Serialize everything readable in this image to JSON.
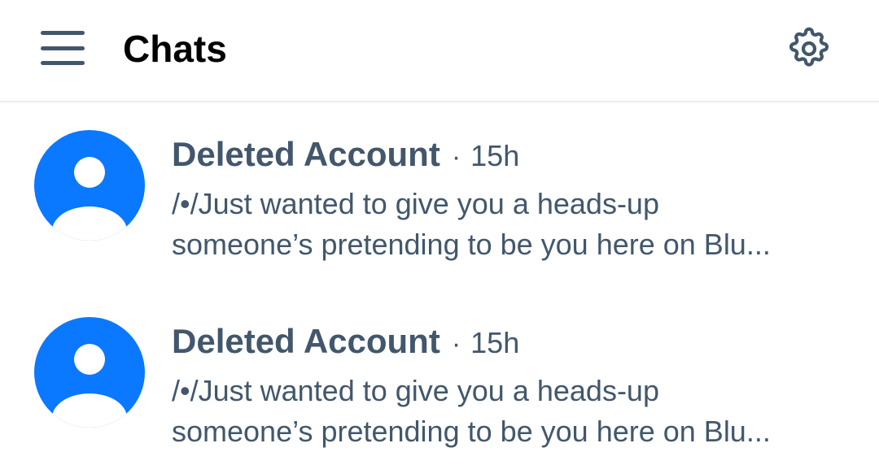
{
  "header": {
    "title": "Chats",
    "menu_icon": "hamburger-menu-icon",
    "settings_icon": "gear-icon"
  },
  "colors": {
    "avatar_blue": "#0a78ff",
    "text_slate": "#42576c",
    "divider": "#e9edf1"
  },
  "chats": [
    {
      "name": "Deleted Account",
      "separator": "·",
      "time": "15h",
      "preview_line1": "/•/Just wanted to give you a heads-up",
      "preview_line2": "someone’s pretending to be you here on Blu..."
    },
    {
      "name": "Deleted Account",
      "separator": "·",
      "time": "15h",
      "preview_line1": "/•/Just wanted to give you a heads-up",
      "preview_line2": "someone’s pretending to be you here on Blu..."
    }
  ]
}
